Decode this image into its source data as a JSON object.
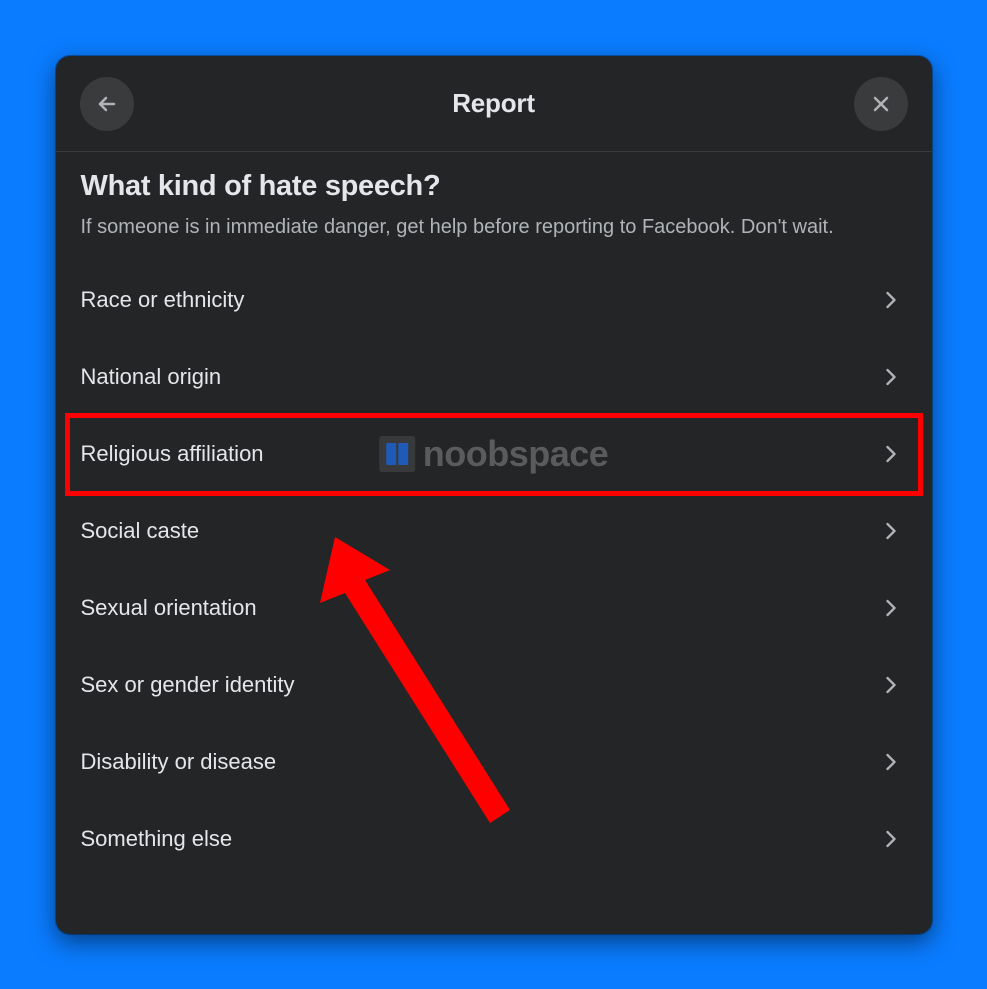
{
  "header": {
    "title": "Report"
  },
  "question": "What kind of hate speech?",
  "subtext": "If someone is in immediate danger, get help before reporting to Facebook. Don't wait.",
  "options": [
    {
      "label": "Race or ethnicity"
    },
    {
      "label": "National origin"
    },
    {
      "label": "Religious affiliation",
      "highlighted": true
    },
    {
      "label": "Social caste"
    },
    {
      "label": "Sexual orientation"
    },
    {
      "label": "Sex or gender identity"
    },
    {
      "label": "Disability or disease"
    },
    {
      "label": "Something else"
    }
  ],
  "watermark": "noobspace",
  "annotation": {
    "highlight_color": "#ff0000",
    "arrow_color": "#ff0000"
  }
}
